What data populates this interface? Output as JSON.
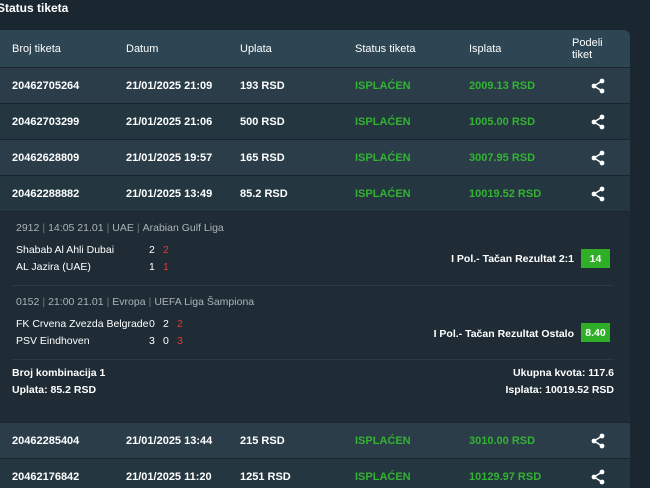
{
  "page_title": "Status tiketa",
  "columns": {
    "ticket": "Broj tiketa",
    "date": "Datum",
    "stake": "Uplata",
    "status": "Status tiketa",
    "payout": "Isplata",
    "share_line1": "Podeli",
    "share_line2": "tiket"
  },
  "rows_top": [
    {
      "ticket": "20462705264",
      "date": "21/01/2025 21:09",
      "stake": "193 RSD",
      "status": "ISPLAĆEN",
      "payout": "2009.13 RSD"
    },
    {
      "ticket": "20462703299",
      "date": "21/01/2025 21:06",
      "stake": "500 RSD",
      "status": "ISPLAĆEN",
      "payout": "1005.00 RSD"
    },
    {
      "ticket": "20462628809",
      "date": "21/01/2025 19:57",
      "stake": "165 RSD",
      "status": "ISPLAĆEN",
      "payout": "3007.95 RSD"
    },
    {
      "ticket": "20462288882",
      "date": "21/01/2025 13:49",
      "stake": "85.2 RSD",
      "status": "ISPLAĆEN",
      "payout": "10019.52 RSD"
    }
  ],
  "detail": {
    "events": [
      {
        "code": "2912",
        "time": "14:05 21.01",
        "country": "UAE",
        "league": "Arabian Gulf Liga",
        "home": "Shabab Al Ahli Dubai",
        "away": "AL Jazira (UAE)",
        "home_scores": [
          "2",
          "2"
        ],
        "away_scores": [
          "1",
          "1"
        ],
        "pick": "I Pol.- Tačan Rezultat 2:1",
        "odd": "14"
      },
      {
        "code": "0152",
        "time": "21:00 21.01",
        "country": "Evropa",
        "league": "UEFA Liga Šampiona",
        "home": "FK Crvena Zvezda Belgrade",
        "away": "PSV Eindhoven",
        "home_scores": [
          "0",
          "2",
          "2"
        ],
        "away_scores": [
          "3",
          "0",
          "3"
        ],
        "pick": "I Pol.- Tačan Rezultat Ostalo",
        "odd": "8.40"
      }
    ],
    "combinations": "Broj kombinacija 1",
    "stake": "Uplata: 85.2 RSD",
    "total_odd": "Ukupna kvota: 117.6",
    "payout": "Isplata: 10019.52 RSD"
  },
  "rows_bottom": [
    {
      "ticket": "20462285404",
      "date": "21/01/2025 13:44",
      "stake": "215 RSD",
      "status": "ISPLAĆEN",
      "payout": "3010.00 RSD"
    },
    {
      "ticket": "20462176842",
      "date": "21/01/2025 11:20",
      "stake": "1251 RSD",
      "status": "ISPLAĆEN",
      "payout": "10129.97 RSD"
    }
  ],
  "colors": {
    "background": "#1b2730",
    "header": "#2e4553",
    "status_green": "#34b233",
    "score_red": "#e03a3a",
    "odd_badge": "#2fae27"
  }
}
